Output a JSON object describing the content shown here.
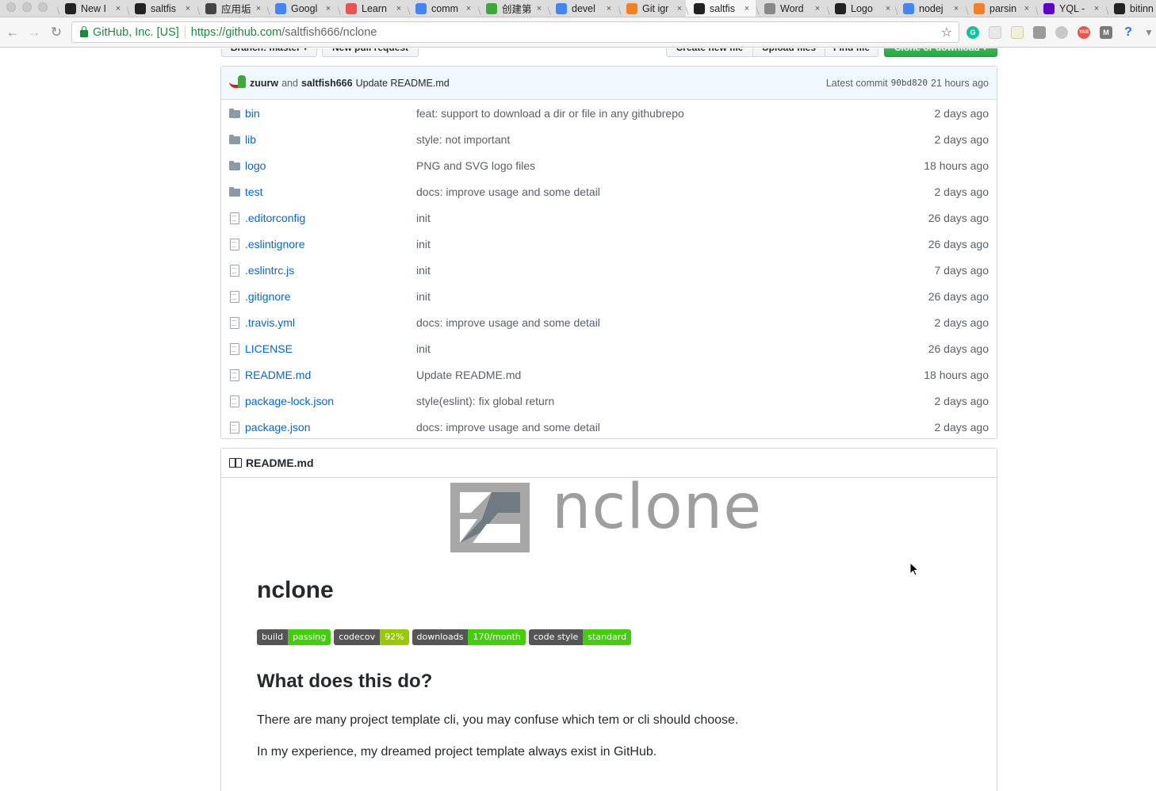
{
  "browser": {
    "tabs": [
      {
        "title": "New I",
        "icon": "github-icon",
        "color": "#222222"
      },
      {
        "title": "saltfis",
        "icon": "github-icon",
        "color": "#222222"
      },
      {
        "title": "应用垢",
        "icon": "book-icon",
        "color": "#444444"
      },
      {
        "title": "Googl",
        "icon": "google-translate-icon",
        "color": "#4285f4"
      },
      {
        "title": "Learn",
        "icon": "udemy-icon",
        "color": "#ec5252"
      },
      {
        "title": "comm",
        "icon": "google-icon",
        "color": "#4285f4"
      },
      {
        "title": "创建第",
        "icon": "chinese-site-icon",
        "color": "#3da83a"
      },
      {
        "title": "devel",
        "icon": "google-icon",
        "color": "#4285f4"
      },
      {
        "title": "Git igr",
        "icon": "stackoverflow-icon",
        "color": "#f48024"
      },
      {
        "title": "saltfis",
        "icon": "github-icon",
        "color": "#222222",
        "active": true
      },
      {
        "title": "Word",
        "icon": "document-icon",
        "color": "#888888"
      },
      {
        "title": "Logo",
        "icon": "github-icon",
        "color": "#222222"
      },
      {
        "title": "nodej",
        "icon": "google-icon",
        "color": "#4285f4"
      },
      {
        "title": "parsin",
        "icon": "stackoverflow-icon",
        "color": "#f48024"
      },
      {
        "title": "YQL -",
        "icon": "yahoo-icon",
        "color": "#5f01d1"
      },
      {
        "title": "bitinn",
        "icon": "github-icon",
        "color": "#222222"
      }
    ],
    "close_glyph": "×",
    "ev_label": "GitHub, Inc. [US]",
    "url_host": "https://github.com",
    "url_path": "/saltfish666/nclone",
    "star_glyph": "☆"
  },
  "repo_actions": {
    "branch": "Branch: master ▾",
    "new_pr": "New pull request",
    "create_file": "Create new file",
    "upload_files": "Upload files",
    "find_file": "Find file",
    "clone": "Clone or download ▾"
  },
  "commit": {
    "author1": "zuurw",
    "and": "and",
    "author2": "saltfish666",
    "message": "Update README.md",
    "latest_label": "Latest commit",
    "sha": "90bd820",
    "time": "21 hours ago"
  },
  "files": [
    {
      "name": "bin",
      "type": "dir",
      "message": "feat: support to download a dir or file in any githubrepo",
      "age": "2 days ago"
    },
    {
      "name": "lib",
      "type": "dir",
      "message": "style: not important",
      "age": "2 days ago"
    },
    {
      "name": "logo",
      "type": "dir",
      "message": "PNG and SVG logo files",
      "age": "18 hours ago"
    },
    {
      "name": "test",
      "type": "dir",
      "message": "docs: improve usage and some detail",
      "age": "2 days ago"
    },
    {
      "name": ".editorconfig",
      "type": "file",
      "message": "init",
      "age": "26 days ago"
    },
    {
      "name": ".eslintignore",
      "type": "file",
      "message": "init",
      "age": "26 days ago"
    },
    {
      "name": ".eslintrc.js",
      "type": "file",
      "message": "init",
      "age": "7 days ago"
    },
    {
      "name": ".gitignore",
      "type": "file",
      "message": "init",
      "age": "26 days ago"
    },
    {
      "name": ".travis.yml",
      "type": "file",
      "message": "docs: improve usage and some detail",
      "age": "2 days ago"
    },
    {
      "name": "LICENSE",
      "type": "file",
      "message": "init",
      "age": "26 days ago"
    },
    {
      "name": "README.md",
      "type": "file",
      "message": "Update README.md",
      "age": "18 hours ago"
    },
    {
      "name": "package-lock.json",
      "type": "file",
      "message": "style(eslint): fix global return",
      "age": "2 days ago"
    },
    {
      "name": "package.json",
      "type": "file",
      "message": "docs: improve usage and some detail",
      "age": "2 days ago"
    }
  ],
  "readme": {
    "filename": "README.md",
    "logo_text": "nclone",
    "title": "nclone",
    "badges": [
      {
        "label": "build",
        "value": "passing",
        "color": "#4c1"
      },
      {
        "label": "codecov",
        "value": "92%",
        "color": "#97ca00"
      },
      {
        "label": "downloads",
        "value": "170/month",
        "color": "#4c1"
      },
      {
        "label": "code style",
        "value": "standard",
        "color": "#4c1"
      }
    ],
    "heading": "What does this do?",
    "paragraphs": [
      "There are many project template cli, you may confuse which tem or cli should choose.",
      "In my experience, my dreamed project template always exist in GitHub."
    ]
  }
}
